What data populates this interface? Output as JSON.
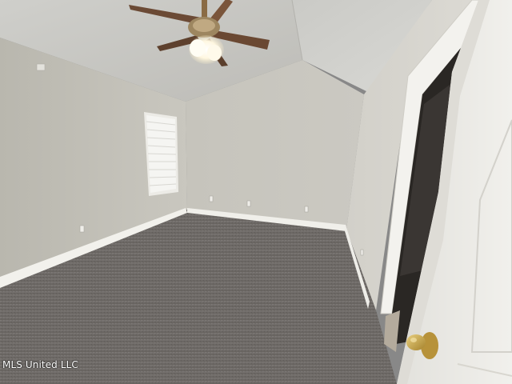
{
  "watermark": {
    "text": "MLS United LLC"
  },
  "colors": {
    "ceiling_left": "#cfcfcb",
    "ceiling_right": "#d2d2cf",
    "back_wall": "#c9c7c0",
    "left_wall": "#c3c1b9",
    "right_wall": "#d3d1ca",
    "carpet": "#6f6b68",
    "baseboard": "#f2f1ec",
    "door": "#ecebe7",
    "door_trim": "#f4f3ef",
    "doorway_dark": "#2a2724",
    "knob": "#c9a64a",
    "fan_blade": "#6b4a35",
    "window_light": "#f3f3f0"
  },
  "scene_elements": [
    "vaulted-ceiling",
    "ceiling-fan",
    "window",
    "carpet-floor",
    "open-door",
    "door-knob",
    "wall-outlets"
  ]
}
